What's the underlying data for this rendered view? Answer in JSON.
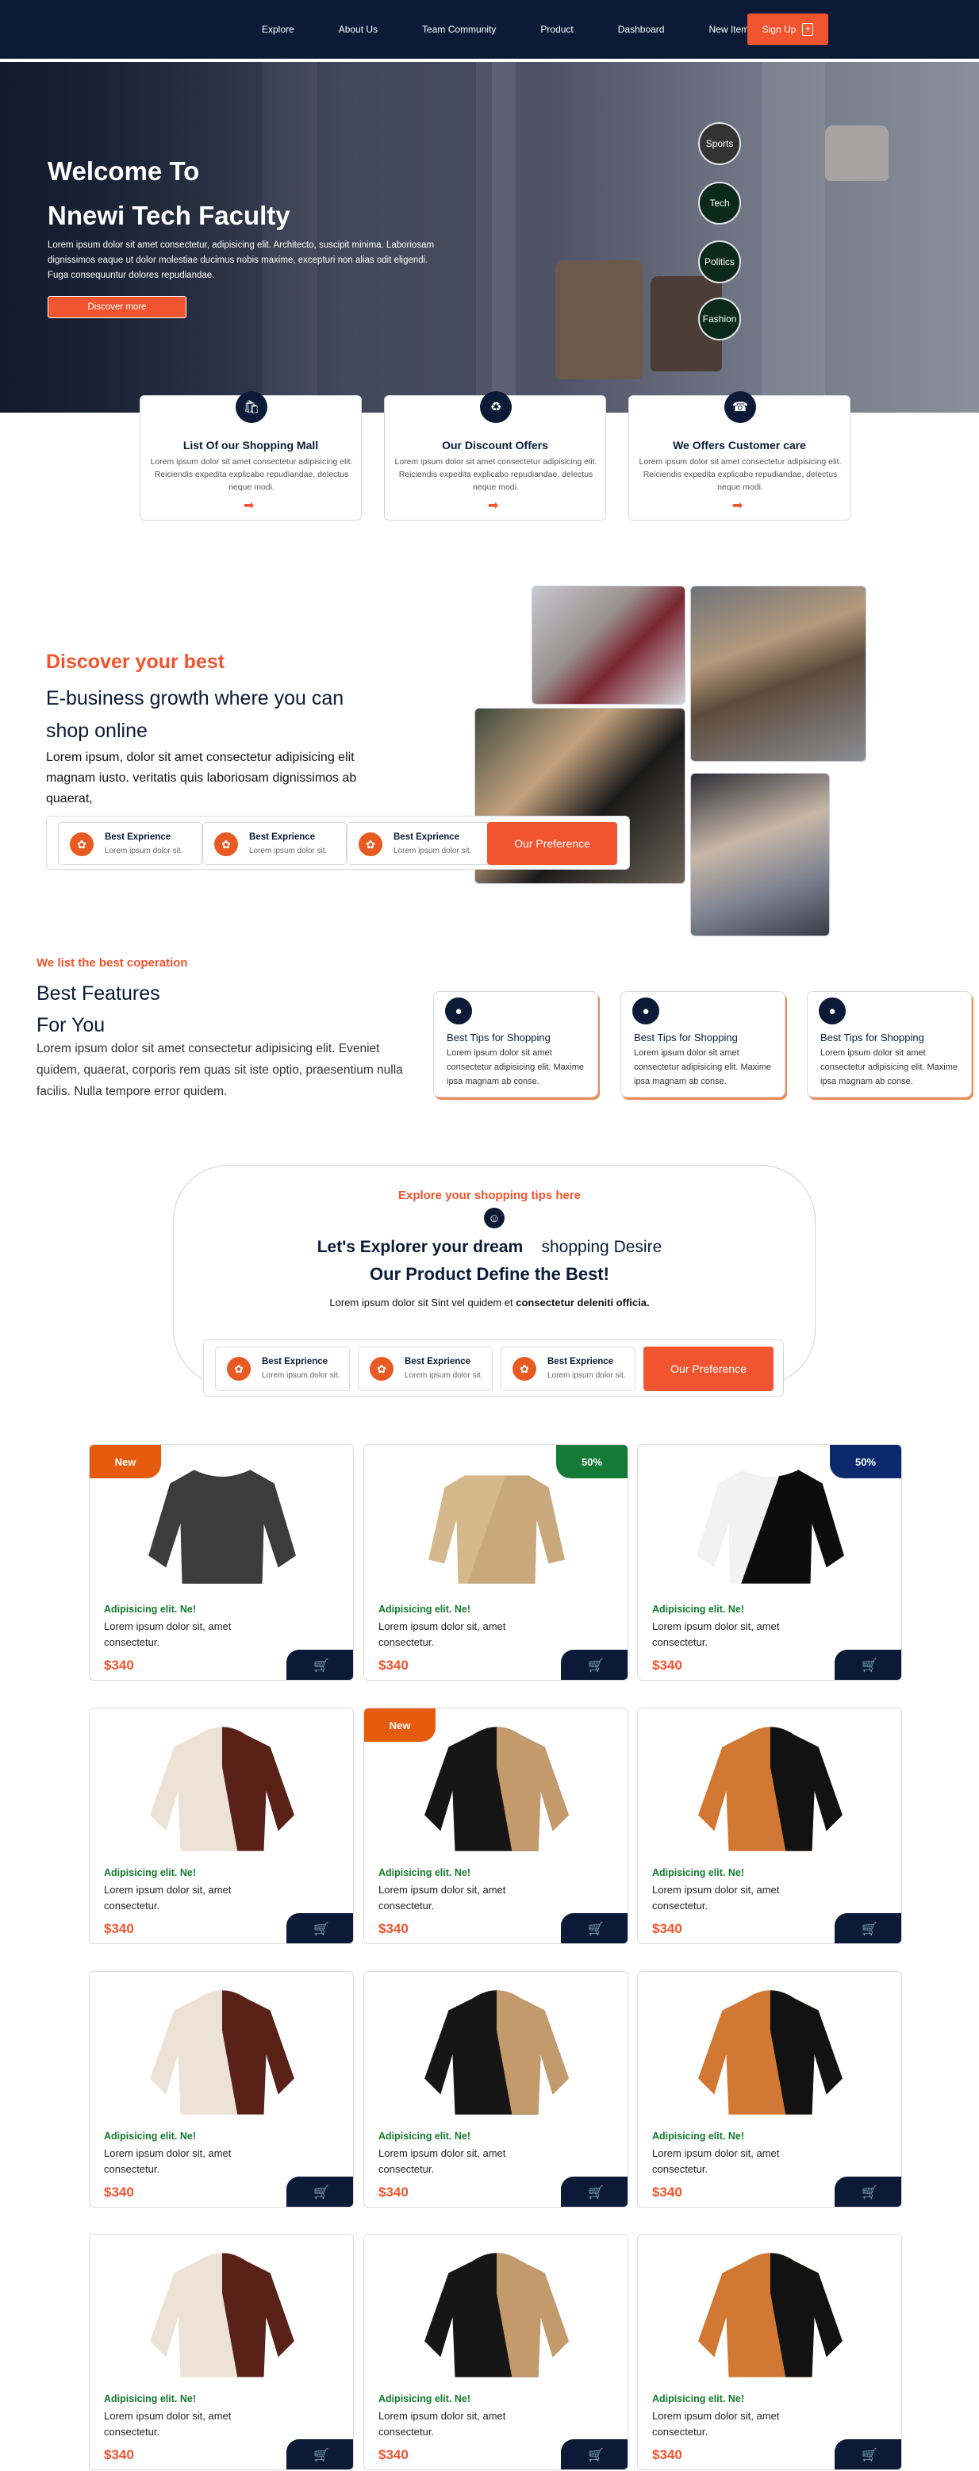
{
  "nav": {
    "links": [
      "Explore",
      "About Us",
      "Team Community",
      "Product",
      "Dashboard",
      "New Items"
    ],
    "signup": "Sign Up",
    "signup_icon": "plus-square-icon"
  },
  "hero": {
    "title_line1": "Welcome To",
    "title_line2": "Nnewi Tech Faculty",
    "text": "Lorem ipsum dolor sit amet consectetur, adipisicing elit. Architecto, suscipit minima. Laboriosam dignissimos eaque ut dolor molestiae ducimus nobis maxime, excepturi non alias odit eligendi. Fuga consequuntur dolores repudiandae.",
    "button": "Discover more",
    "categories": [
      "Sports",
      "Tech",
      "Politics",
      "Fashion"
    ]
  },
  "services": [
    {
      "icon": "shopping-bag-icon",
      "title": "List Of our Shopping Mall",
      "text": "Lorem ipsum dolor sit amet consectetur adipisicing elit. Reiciendis expedita explicabo repudiandae, delectus neque modi.",
      "arrow": "➡"
    },
    {
      "icon": "tag-icon",
      "title": "Our Discount Offers",
      "text": "Lorem ipsum dolor sit amet consectetur adipisicing elit. Reiciendis expedita explicabo repudiandae, delectus neque modi.",
      "arrow": "➡"
    },
    {
      "icon": "headset-icon",
      "title": "We Offers Customer care",
      "text": "Lorem ipsum dolor sit amet consectetur adipisicing elit. Reiciendis expedita explicabo repudiandae, delectus neque modi.",
      "arrow": "➡"
    }
  ],
  "discover": {
    "kicker": "Discover your best",
    "heading": "E-business growth where you can shop online",
    "text": "Lorem ipsum, dolor sit amet consectetur adipisicing elit magnam iusto. veritatis quis laboriosam dignissimos ab quaerat,",
    "pills": [
      {
        "title": "Best Exprience",
        "sub": "Lorem ipsum dolor sit."
      },
      {
        "title": "Best Exprience",
        "sub": "Lorem ipsum dolor sit."
      },
      {
        "title": "Best Exprience",
        "sub": "Lorem ipsum dolor sit."
      }
    ],
    "button": "Our Preference"
  },
  "features": {
    "kicker": "We list the best coperation",
    "heading_line1": "Best Features",
    "heading_line2": "For You",
    "text": "Lorem ipsum dolor sit amet consectetur adipisicing elit. Eveniet quidem, quaerat, corporis rem quas sit iste optio, praesentium nulla facilis. Nulla tempore error quidem.",
    "tips": [
      {
        "title": "Best Tips for Shopping",
        "text": "Lorem ipsum dolor sit amet consectetur adipisicing elit. Maxime ipsa magnam ab conse."
      },
      {
        "title": "Best Tips for Shopping",
        "text": "Lorem ipsum dolor sit amet consectetur adipisicing elit. Maxime ipsa magnam ab conse."
      },
      {
        "title": "Best Tips for Shopping",
        "text": "Lorem ipsum dolor sit amet consectetur adipisicing elit. Maxime ipsa magnam ab conse."
      }
    ]
  },
  "explore": {
    "kicker": "Explore your shopping tips here",
    "line1_bold": "Let's Explorer your dream",
    "line1_rest": "shopping Desire",
    "line2": "Our Product Define the Best!",
    "line3_plain": "Lorem ipsum dolor sit Sint vel quidem et",
    "line3_bold": "consectetur deleniti officia.",
    "pills": [
      {
        "title": "Best Exprience",
        "sub": "Lorem ipsum dolor sit."
      },
      {
        "title": "Best Exprience",
        "sub": "Lorem ipsum dolor sit."
      },
      {
        "title": "Best Exprience",
        "sub": "Lorem ipsum dolor sit."
      }
    ],
    "button": "Our Preference"
  },
  "products": [
    {
      "badge": "New",
      "badge_color": "#e75b0e",
      "name": "Adipisicing elit. Ne!",
      "desc": "Lorem ipsum dolor sit, amet consectetur.",
      "price": "$340",
      "garment": "sweatshirt-gray"
    },
    {
      "badge": "50%",
      "badge_color": "#157a35",
      "name": "Adipisicing elit. Ne!",
      "desc": "Lorem ipsum dolor sit, amet consectetur.",
      "price": "$340",
      "garment": "jacket-set-beige"
    },
    {
      "badge": "50%",
      "badge_color": "#0b2a6e",
      "name": "Adipisicing elit. Ne!",
      "desc": "Lorem ipsum dolor sit, amet consectetur.",
      "price": "$340",
      "garment": "sweatshirt-black-white"
    },
    {
      "badge": "",
      "badge_color": "",
      "name": "Adipisicing elit. Ne!",
      "desc": "Lorem ipsum dolor sit, amet consectetur.",
      "price": "$340",
      "garment": "hoodie-cream-maroon"
    },
    {
      "badge": "New",
      "badge_color": "#e75b0e",
      "name": "Adipisicing elit. Ne!",
      "desc": "Lorem ipsum dolor sit, amet consectetur.",
      "price": "$340",
      "garment": "hoodie-black-tan"
    },
    {
      "badge": "",
      "badge_color": "",
      "name": "Adipisicing elit. Ne!",
      "desc": "Lorem ipsum dolor sit, amet consectetur.",
      "price": "$340",
      "garment": "hoodie-orange-black"
    },
    {
      "badge": "",
      "badge_color": "",
      "name": "Adipisicing elit. Ne!",
      "desc": "Lorem ipsum dolor sit, amet consectetur.",
      "price": "$340",
      "garment": "hoodie-cream-maroon"
    },
    {
      "badge": "",
      "badge_color": "",
      "name": "Adipisicing elit. Ne!",
      "desc": "Lorem ipsum dolor sit, amet consectetur.",
      "price": "$340",
      "garment": "hoodie-black-tan"
    },
    {
      "badge": "",
      "badge_color": "",
      "name": "Adipisicing elit. Ne!",
      "desc": "Lorem ipsum dolor sit, amet consectetur.",
      "price": "$340",
      "garment": "hoodie-orange-black"
    },
    {
      "badge": "",
      "badge_color": "",
      "name": "Adipisicing elit. Ne!",
      "desc": "Lorem ipsum dolor sit, amet consectetur.",
      "price": "$340",
      "garment": "hoodie-cream-maroon"
    },
    {
      "badge": "",
      "badge_color": "",
      "name": "Adipisicing elit. Ne!",
      "desc": "Lorem ipsum dolor sit, amet consectetur.",
      "price": "$340",
      "garment": "hoodie-black-tan"
    },
    {
      "badge": "",
      "badge_color": "",
      "name": "Adipisicing elit. Ne!",
      "desc": "Lorem ipsum dolor sit, amet consectetur.",
      "price": "$340",
      "garment": "hoodie-orange-black"
    }
  ],
  "colors": {
    "navy": "#0b1a36",
    "accent": "#f1542e",
    "green": "#137a2c"
  }
}
